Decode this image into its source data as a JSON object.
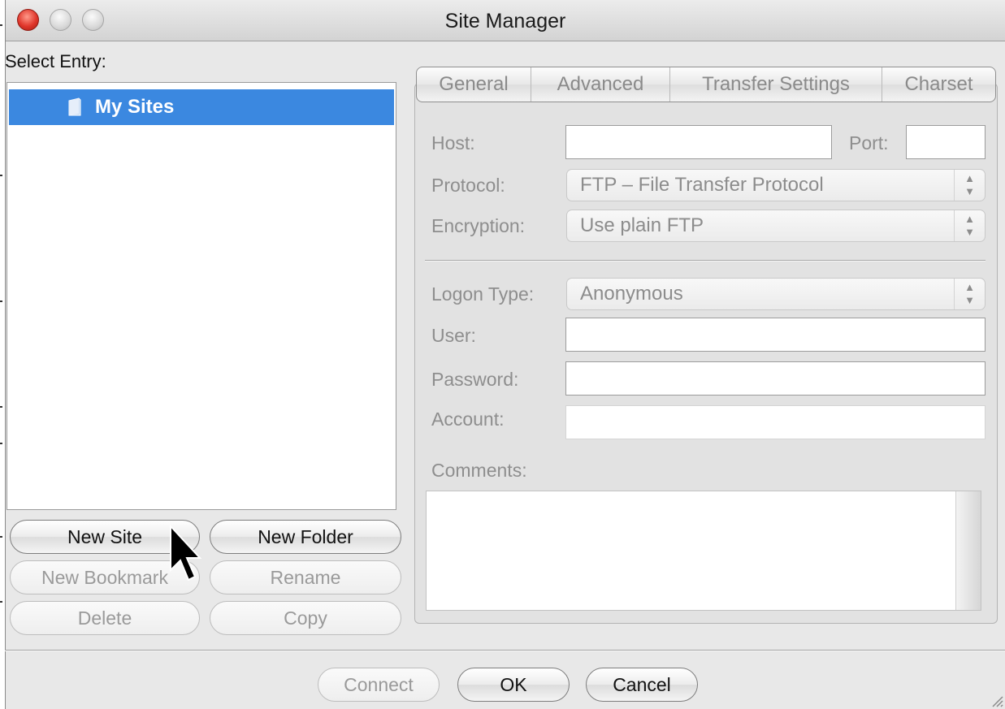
{
  "window": {
    "title": "Site Manager"
  },
  "left_panel": {
    "select_entry_label": "Select Entry:",
    "tree": {
      "items": [
        {
          "label": "My Sites",
          "icon": "folder-icon",
          "selected": true
        }
      ]
    },
    "buttons": {
      "new_site": "New Site",
      "new_folder": "New Folder",
      "new_bookmark": "New Bookmark",
      "rename": "Rename",
      "delete": "Delete",
      "copy": "Copy"
    }
  },
  "tabs": [
    {
      "label": "General",
      "selected": true
    },
    {
      "label": "Advanced"
    },
    {
      "label": "Transfer Settings"
    },
    {
      "label": "Charset"
    }
  ],
  "general": {
    "host_label": "Host:",
    "host_value": "",
    "port_label": "Port:",
    "port_value": "",
    "protocol_label": "Protocol:",
    "protocol_value": "FTP – File Transfer Protocol",
    "encryption_label": "Encryption:",
    "encryption_value": "Use plain FTP",
    "logon_type_label": "Logon Type:",
    "logon_type_value": "Anonymous",
    "user_label": "User:",
    "user_value": "",
    "password_label": "Password:",
    "password_value": "",
    "account_label": "Account:",
    "account_value": "",
    "comments_label": "Comments:",
    "comments_value": ""
  },
  "footer": {
    "connect": "Connect",
    "ok": "OK",
    "cancel": "Cancel"
  },
  "colors": {
    "selection": "#3b88e0",
    "close_button": "#e0362b"
  }
}
